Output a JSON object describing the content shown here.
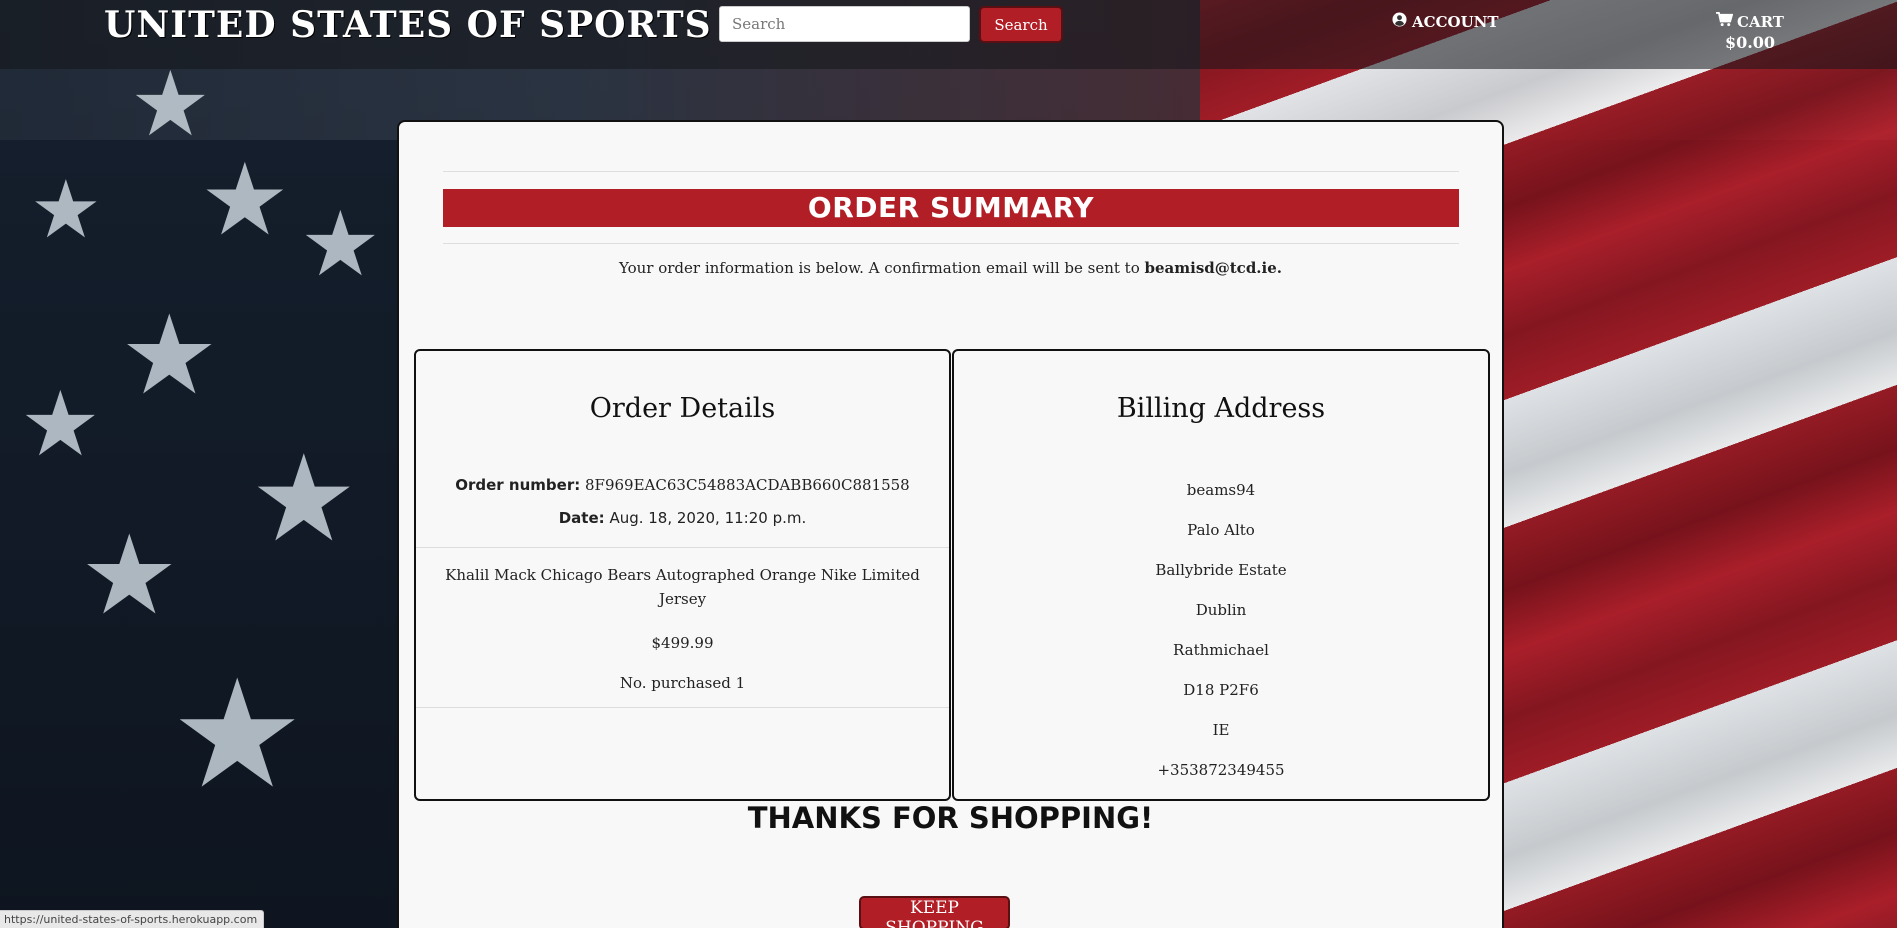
{
  "header": {
    "brand": "UNITED STATES OF SPORTS",
    "search_placeholder": "Search",
    "search_button": "Search",
    "account_label": "ACCOUNT",
    "cart_label": "CART",
    "cart_total": "$0.00",
    "icons": [
      "user-circle-icon",
      "shopping-cart-icon"
    ]
  },
  "summary": {
    "banner": "ORDER SUMMARY",
    "info_prefix": "Your order information is below. A confirmation email will be sent to ",
    "email": "beamisd@tcd.ie."
  },
  "order_details": {
    "title": "Order Details",
    "order_number_label": "Order number:",
    "order_number": "8F969EAC63C54883ACDABB660C881558",
    "date_label": "Date:",
    "date": "Aug. 18, 2020, 11:20 p.m.",
    "item_name": "Khalil Mack Chicago Bears Autographed Orange Nike Limited Jersey",
    "item_price": "$499.99",
    "item_qty": "No. purchased 1"
  },
  "billing": {
    "title": "Billing Address",
    "lines": [
      "beams94",
      "Palo Alto",
      "Ballybride Estate",
      "Dublin",
      "Rathmichael",
      "D18 P2F6",
      "IE",
      "+353872349455"
    ]
  },
  "footer": {
    "thanks": "THANKS FOR SHOPPING!",
    "keep_shopping": "KEEP SHOPPING"
  },
  "status_bar": {
    "url": "https://united-states-of-sports.herokuapp.com"
  },
  "colors": {
    "accent_red": "#b21e25",
    "card_bg": "#f8f8f8",
    "navbar_bg": "#14161a"
  }
}
